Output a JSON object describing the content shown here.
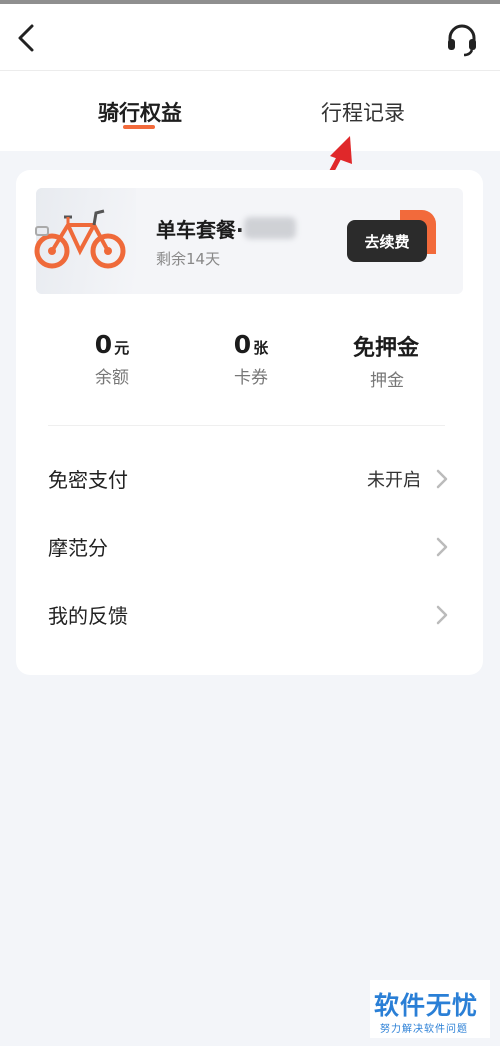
{
  "header": {
    "back_icon": "back-arrow-icon",
    "support_icon": "headset-icon"
  },
  "tabs": [
    {
      "label": "骑行权益",
      "active": true
    },
    {
      "label": "行程记录",
      "active": false
    }
  ],
  "plan": {
    "title": "单车套餐·",
    "remaining": "剩余14天",
    "renew_label": "去续费"
  },
  "stats": [
    {
      "value": "0",
      "unit": "元",
      "label": "余额"
    },
    {
      "value": "0",
      "unit": "张",
      "label": "卡券"
    },
    {
      "value": "免押金",
      "unit": "",
      "label": "押金"
    }
  ],
  "menu": [
    {
      "label": "免密支付",
      "value": "未开启"
    },
    {
      "label": "摩范分",
      "value": ""
    },
    {
      "label": "我的反馈",
      "value": ""
    }
  ],
  "watermark": {
    "title": "软件无忧",
    "subtitle": "努力解决软件问题"
  },
  "colors": {
    "accent": "#f26a3b",
    "annotation_arrow": "#e0282a",
    "watermark": "#2a7fd6"
  }
}
